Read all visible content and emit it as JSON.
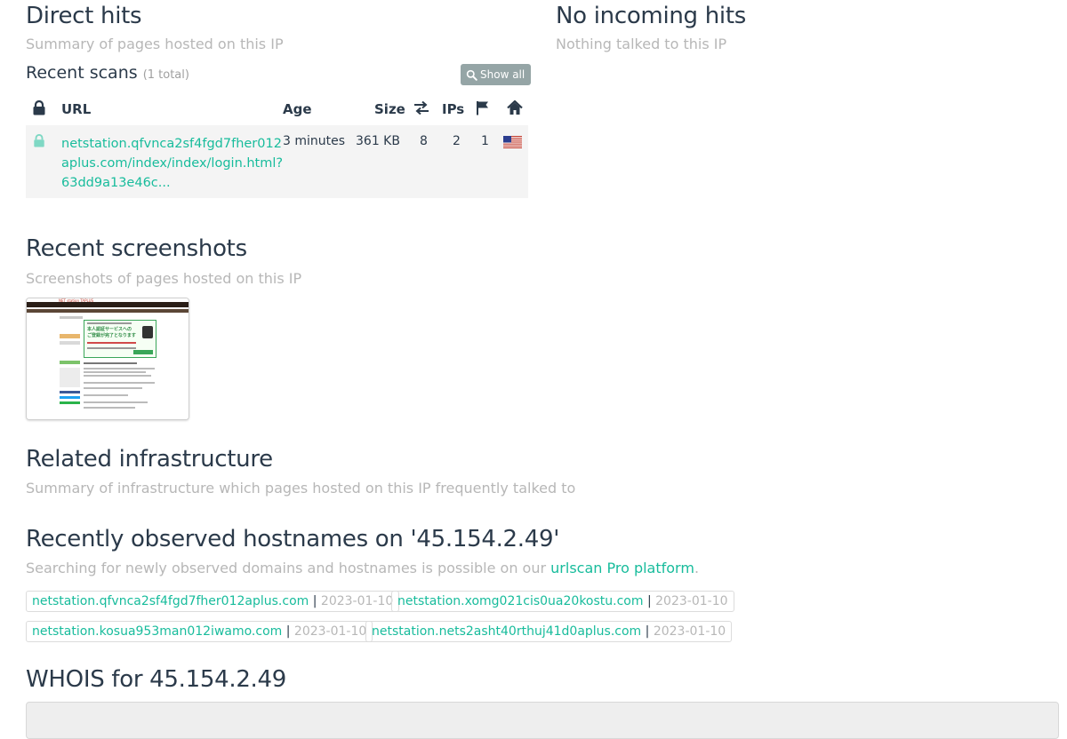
{
  "direct_hits": {
    "title": "Direct hits",
    "subtitle": "Summary of pages hosted on this IP"
  },
  "incoming_hits": {
    "title": "No incoming hits",
    "subtitle": "Nothing talked to this IP"
  },
  "recent_scans": {
    "title": "Recent scans",
    "count_label": "(1 total)",
    "show_all_label": "Show all",
    "columns": {
      "lock_icon": "lock-icon",
      "url": "URL",
      "age": "Age",
      "size": "Size",
      "transfers_icon": "exchange-icon",
      "ips": "IPs",
      "flag_icon": "flag-icon",
      "home_icon": "home-icon"
    },
    "rows": [
      {
        "url_line1": "netstation.qfvnca2sf4fgd7fher012",
        "url_line2": "aplus.com/index/index/login.html?",
        "url_line3": "63dd9a13e46c...",
        "age": "3 minutes",
        "size": "361 KB",
        "transfers": "8",
        "ips": "2",
        "countries": "1",
        "country_icon": "us-flag-icon"
      }
    ]
  },
  "recent_screenshots": {
    "title": "Recent screenshots",
    "subtitle": "Screenshots of pages hosted on this IP",
    "thumbnail_header": "NET station TAPLUS",
    "thumbnail_banner1": "本人認証サービスへの",
    "thumbnail_banner2": "ご登録が完了となります"
  },
  "related_infrastructure": {
    "title": "Related infrastructure",
    "subtitle": "Summary of infrastructure which pages hosted on this IP frequently talked to"
  },
  "hostnames": {
    "title": "Recently observed hostnames on '45.154.2.49'",
    "subtitle_prefix": "Searching for newly observed domains and hostnames is possible on our ",
    "subtitle_link": "urlscan Pro platform",
    "subtitle_suffix": ".",
    "separator": "|",
    "items": [
      {
        "host": "netstation.qfvnca2sf4fgd7fher012aplus.com",
        "date": "2023-01-10"
      },
      {
        "host": "netstation.xomg021cis0ua20kostu.com",
        "date": "2023-01-10"
      },
      {
        "host": "netstation.kosua953man012iwamo.com",
        "date": "2023-01-10"
      },
      {
        "host": "netstation.nets2asht40rthuj41d0aplus.com",
        "date": "2023-01-10"
      }
    ]
  },
  "whois": {
    "title": "WHOIS for 45.154.2.49"
  },
  "colors": {
    "accent": "#18bc9c",
    "muted": "#b7b7b7",
    "heading": "#2b3a4a",
    "button": "#95a5a6"
  }
}
